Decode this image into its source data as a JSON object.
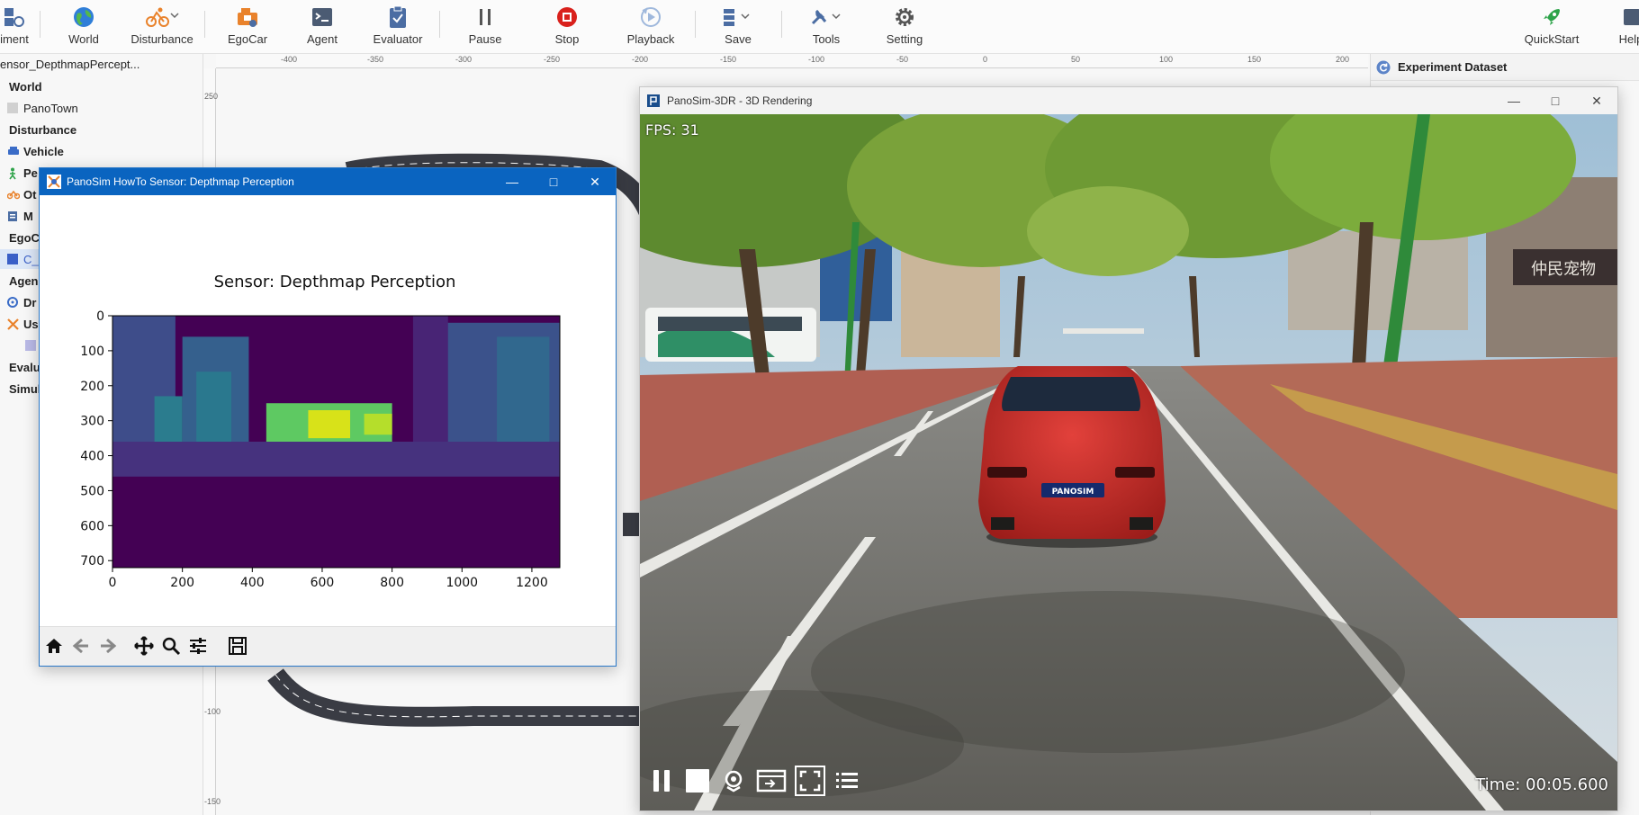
{
  "toolbar": {
    "items": [
      {
        "label": "iment",
        "icon": "experiment-icon"
      },
      {
        "label": "World",
        "icon": "globe-icon"
      },
      {
        "label": "Disturbance",
        "icon": "disturbance-icon"
      },
      {
        "label": "EgoCar",
        "icon": "egocar-icon"
      },
      {
        "label": "Agent",
        "icon": "agent-icon"
      },
      {
        "label": "Evaluator",
        "icon": "evaluator-icon"
      },
      {
        "label": "Pause",
        "icon": "pause-icon"
      },
      {
        "label": "Stop",
        "icon": "stop-icon"
      },
      {
        "label": "Playback",
        "icon": "playback-icon"
      },
      {
        "label": "Save",
        "icon": "save-icon"
      },
      {
        "label": "Tools",
        "icon": "tools-icon"
      },
      {
        "label": "Setting",
        "icon": "gear-icon"
      },
      {
        "label": "QuickStart",
        "icon": "rocket-icon"
      },
      {
        "label": "Help",
        "icon": "help-icon"
      }
    ],
    "colors": {
      "stop": "#d9211c",
      "egocar": "#e9822b",
      "rocket": "#2ea34a",
      "blue": "#4b6da3"
    }
  },
  "tree": {
    "title": "ensor_DepthmapPercept...",
    "rows": [
      {
        "label": "World",
        "bold": true
      },
      {
        "label": "PanoTown",
        "bold": false
      },
      {
        "label": "Disturbance",
        "bold": true
      },
      {
        "label": "Vehicle",
        "bold": true
      },
      {
        "label": "Pe",
        "bold": true
      },
      {
        "label": "Ot",
        "bold": true
      },
      {
        "label": "M",
        "bold": true
      },
      {
        "label": "EgoC",
        "bold": true
      },
      {
        "label": "C_C",
        "bold": false
      },
      {
        "label": "Agen",
        "bold": true
      },
      {
        "label": "Dr",
        "bold": true
      },
      {
        "label": "Us",
        "bold": true
      },
      {
        "label": "",
        "bold": false
      },
      {
        "label": "Evalu",
        "bold": true
      },
      {
        "label": "Simul",
        "bold": true
      }
    ]
  },
  "ruler": {
    "top": [
      "-400",
      "-350",
      "-300",
      "-250",
      "-200",
      "-150",
      "-100",
      "-50",
      "0",
      "50",
      "100",
      "150",
      "200"
    ],
    "left": [
      "250",
      "-100",
      "-150"
    ]
  },
  "right_panel": {
    "title": "Experiment Dataset",
    "partial": "on"
  },
  "depth_window": {
    "title": "PanoSim HowTo Sensor: Depthmap Perception",
    "toolbar_icons": [
      "home-icon",
      "back-arrow-icon",
      "forward-arrow-icon",
      "pan-icon",
      "zoom-icon",
      "configure-icon",
      "save-figure-icon"
    ]
  },
  "chart_data": {
    "type": "heatmap",
    "title": "Sensor: Depthmap Perception",
    "xlabel": "",
    "ylabel": "",
    "xlim": [
      0,
      1280
    ],
    "ylim": [
      720,
      0
    ],
    "xticks": [
      "0",
      "200",
      "400",
      "600",
      "800",
      "1000",
      "1200"
    ],
    "yticks": [
      "0",
      "100",
      "200",
      "300",
      "400",
      "500",
      "600",
      "700"
    ],
    "colormap": "viridis"
  },
  "render_window": {
    "title": "PanoSim-3DR - 3D Rendering",
    "fps": "FPS: 31",
    "time": "Time: 00:05.600",
    "plate": "PANOSIM",
    "controls": [
      "pause-icon",
      "stop-icon",
      "location-icon",
      "screen-icon",
      "fullscreen-icon",
      "list-icon"
    ]
  }
}
